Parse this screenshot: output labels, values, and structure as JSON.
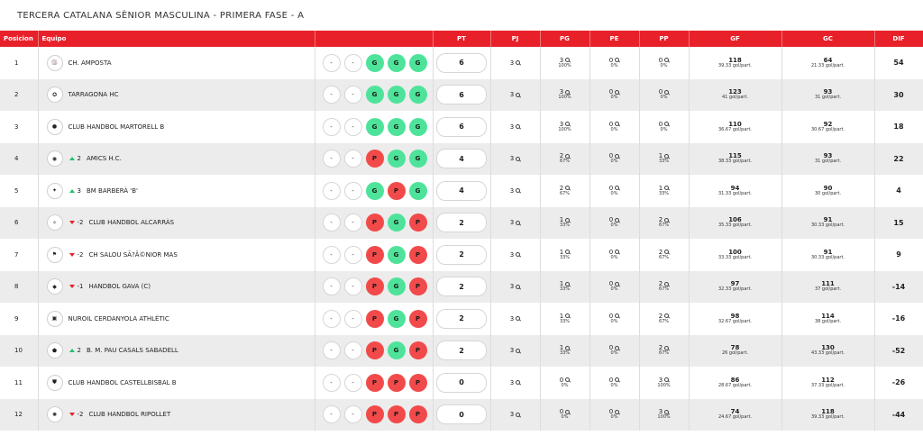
{
  "page_title": "TERCERA CATALANA SÈNIOR MASCULINA - PRIMERA FASE - A",
  "headers": {
    "pos": "Posicion",
    "team": "Equipo",
    "forms": "",
    "pt": "PT",
    "pj": "PJ",
    "pg": "PG",
    "pe": "PE",
    "pp": "PP",
    "gf": "GF",
    "gc": "GC",
    "dif": "DIF"
  },
  "accent_color": "#e8202a",
  "win_color": "#4ee39a",
  "loss_color": "#f24a4a",
  "rows": [
    {
      "pos": "1",
      "trend": "",
      "trend_dir": "",
      "name": "CH. AMPOSTA",
      "logo": "🏐",
      "forms": [
        "-",
        "-",
        "G",
        "G",
        "G"
      ],
      "pt": "6",
      "pj": "3",
      "pg": "3",
      "pg_pct": "100%",
      "pe": "0",
      "pe_pct": "0%",
      "pp": "0",
      "pp_pct": "0%",
      "gf": "118",
      "gf_sub": "39.33 gol/part.",
      "gc": "64",
      "gc_sub": "21.33 gol/part.",
      "dif": "54"
    },
    {
      "pos": "2",
      "trend": "",
      "trend_dir": "",
      "name": "TARRAGONA HC",
      "logo": "✪",
      "forms": [
        "-",
        "-",
        "G",
        "G",
        "G"
      ],
      "pt": "6",
      "pj": "3",
      "pg": "3",
      "pg_pct": "100%",
      "pe": "0",
      "pe_pct": "0%",
      "pp": "0",
      "pp_pct": "0%",
      "gf": "123",
      "gf_sub": "41 gol/part.",
      "gc": "93",
      "gc_sub": "31 gol/part.",
      "dif": "30"
    },
    {
      "pos": "3",
      "trend": "",
      "trend_dir": "",
      "name": "CLUB HANDBOL MARTORELL B",
      "logo": "●",
      "forms": [
        "-",
        "-",
        "G",
        "G",
        "G"
      ],
      "pt": "6",
      "pj": "3",
      "pg": "3",
      "pg_pct": "100%",
      "pe": "0",
      "pe_pct": "0%",
      "pp": "0",
      "pp_pct": "0%",
      "gf": "110",
      "gf_sub": "36.67 gol/part.",
      "gc": "92",
      "gc_sub": "30.67 gol/part.",
      "dif": "18"
    },
    {
      "pos": "4",
      "trend": "2",
      "trend_dir": "up",
      "name": "AMICS H.C.",
      "logo": "◉",
      "forms": [
        "-",
        "-",
        "P",
        "G",
        "G"
      ],
      "pt": "4",
      "pj": "3",
      "pg": "2",
      "pg_pct": "67%",
      "pe": "0",
      "pe_pct": "0%",
      "pp": "1",
      "pp_pct": "33%",
      "gf": "115",
      "gf_sub": "38.33 gol/part.",
      "gc": "93",
      "gc_sub": "31 gol/part.",
      "dif": "22"
    },
    {
      "pos": "5",
      "trend": "3",
      "trend_dir": "up",
      "name": "BM BARBERÀ 'B'",
      "logo": "✦",
      "forms": [
        "-",
        "-",
        "G",
        "P",
        "G"
      ],
      "pt": "4",
      "pj": "3",
      "pg": "2",
      "pg_pct": "67%",
      "pe": "0",
      "pe_pct": "0%",
      "pp": "1",
      "pp_pct": "33%",
      "gf": "94",
      "gf_sub": "31.33 gol/part.",
      "gc": "90",
      "gc_sub": "30 gol/part.",
      "dif": "4"
    },
    {
      "pos": "6",
      "trend": "-2",
      "trend_dir": "down",
      "name": "CLUB HANDBOL ALCARRÀS",
      "logo": "✧",
      "forms": [
        "-",
        "-",
        "P",
        "G",
        "P"
      ],
      "pt": "2",
      "pj": "3",
      "pg": "1",
      "pg_pct": "33%",
      "pe": "0",
      "pe_pct": "0%",
      "pp": "2",
      "pp_pct": "67%",
      "gf": "106",
      "gf_sub": "35.33 gol/part.",
      "gc": "91",
      "gc_sub": "30.33 gol/part.",
      "dif": "15"
    },
    {
      "pos": "7",
      "trend": "-2",
      "trend_dir": "down",
      "name": "CH SALOU SÃ?Â©NIOR MAS",
      "logo": "⚑",
      "forms": [
        "-",
        "-",
        "P",
        "G",
        "P"
      ],
      "pt": "2",
      "pj": "3",
      "pg": "1",
      "pg_pct": "33%",
      "pe": "0",
      "pe_pct": "0%",
      "pp": "2",
      "pp_pct": "67%",
      "gf": "100",
      "gf_sub": "33.33 gol/part.",
      "gc": "91",
      "gc_sub": "30.33 gol/part.",
      "dif": "9"
    },
    {
      "pos": "8",
      "trend": "-1",
      "trend_dir": "down",
      "name": "HANDBOL GAVA (C)",
      "logo": "◆",
      "forms": [
        "-",
        "-",
        "P",
        "G",
        "P"
      ],
      "pt": "2",
      "pj": "3",
      "pg": "1",
      "pg_pct": "33%",
      "pe": "0",
      "pe_pct": "0%",
      "pp": "2",
      "pp_pct": "67%",
      "gf": "97",
      "gf_sub": "32.33 gol/part.",
      "gc": "111",
      "gc_sub": "37 gol/part.",
      "dif": "-14"
    },
    {
      "pos": "9",
      "trend": "",
      "trend_dir": "",
      "name": "NUROIL CERDANYOLA ATHLÈTIC",
      "logo": "▣",
      "forms": [
        "-",
        "-",
        "P",
        "G",
        "P"
      ],
      "pt": "2",
      "pj": "3",
      "pg": "1",
      "pg_pct": "33%",
      "pe": "0",
      "pe_pct": "0%",
      "pp": "2",
      "pp_pct": "67%",
      "gf": "98",
      "gf_sub": "32.67 gol/part.",
      "gc": "114",
      "gc_sub": "38 gol/part.",
      "dif": "-16"
    },
    {
      "pos": "10",
      "trend": "2",
      "trend_dir": "up",
      "name": "B. M. PAU CASALS SABADELL",
      "logo": "⬟",
      "forms": [
        "-",
        "-",
        "P",
        "G",
        "P"
      ],
      "pt": "2",
      "pj": "3",
      "pg": "1",
      "pg_pct": "33%",
      "pe": "0",
      "pe_pct": "0%",
      "pp": "2",
      "pp_pct": "67%",
      "gf": "78",
      "gf_sub": "26 gol/part.",
      "gc": "130",
      "gc_sub": "43.33 gol/part.",
      "dif": "-52"
    },
    {
      "pos": "11",
      "trend": "",
      "trend_dir": "",
      "name": "CLUB HANDBOL CASTELLBISBAL B",
      "logo": "⛊",
      "forms": [
        "-",
        "-",
        "P",
        "P",
        "P"
      ],
      "pt": "0",
      "pj": "3",
      "pg": "0",
      "pg_pct": "0%",
      "pe": "0",
      "pe_pct": "0%",
      "pp": "3",
      "pp_pct": "100%",
      "gf": "86",
      "gf_sub": "28.67 gol/part.",
      "gc": "112",
      "gc_sub": "37.33 gol/part.",
      "dif": "-26"
    },
    {
      "pos": "12",
      "trend": "-2",
      "trend_dir": "down",
      "name": "CLUB HANDBOL RIPOLLET",
      "logo": "✺",
      "forms": [
        "-",
        "-",
        "P",
        "P",
        "P"
      ],
      "pt": "0",
      "pj": "3",
      "pg": "0",
      "pg_pct": "0%",
      "pe": "0",
      "pe_pct": "0%",
      "pp": "3",
      "pp_pct": "100%",
      "gf": "74",
      "gf_sub": "24.67 gol/part.",
      "gc": "118",
      "gc_sub": "39.33 gol/part.",
      "dif": "-44"
    }
  ]
}
